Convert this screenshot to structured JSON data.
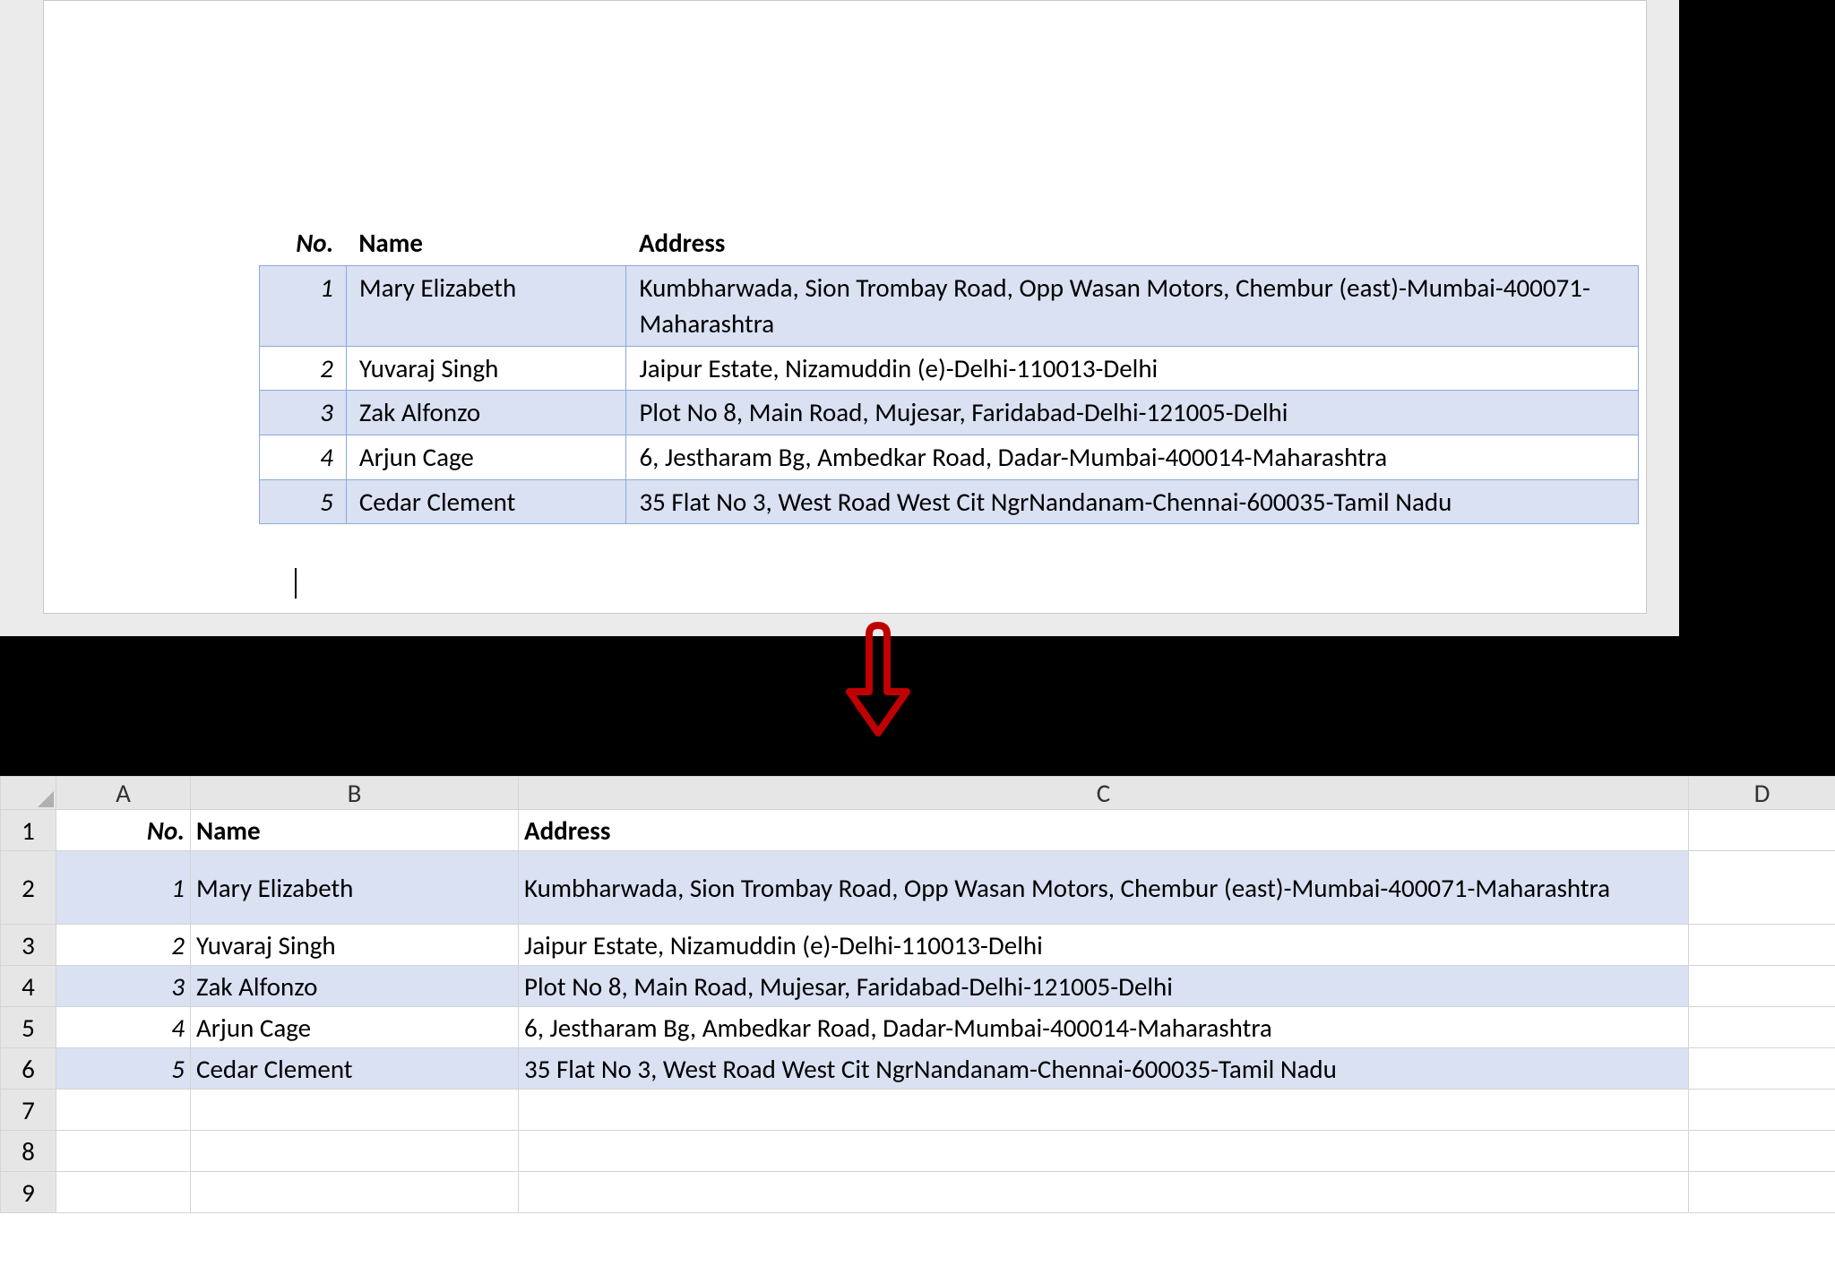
{
  "columns": {
    "A": "A",
    "B": "B",
    "C": "C",
    "D": "D"
  },
  "headers": {
    "no": "No.",
    "name": "Name",
    "address": "Address"
  },
  "rows": [
    {
      "no": "1",
      "name": "Mary Elizabeth",
      "address_top": "Kumbharwada, Sion Trombay Road, Opp Wasan Motors, Chembur (east)-Mumbai-400071-Maharashtra",
      "address_bottom": "Kumbharwada, Sion Trombay Road, Opp Wasan Motors, Chembur (east)-Mumbai-400071-Maharashtra"
    },
    {
      "no": "2",
      "name": "Yuvaraj Singh",
      "address_top": "Jaipur Estate, Nizamuddin (e)-Delhi-110013-Delhi",
      "address_bottom": "Jaipur Estate, Nizamuddin (e)-Delhi-110013-Delhi"
    },
    {
      "no": "3",
      "name": "Zak Alfonzo",
      "address_top": "Plot No 8, Main Road, Mujesar, Faridabad-Delhi-121005-Delhi",
      "address_bottom": "Plot No 8, Main Road, Mujesar, Faridabad-Delhi-121005-Delhi"
    },
    {
      "no": "4",
      "name": "Arjun Cage",
      "address_top": "6, Jestharam Bg, Ambedkar Road, Dadar-Mumbai-400014-Maharashtra",
      "address_bottom": "6, Jestharam Bg, Ambedkar Road, Dadar-Mumbai-400014-Maharashtra"
    },
    {
      "no": "5",
      "name": "Cedar Clement",
      "address_top": "35 Flat No 3, West Road West Cit NgrNandanam-Chennai-600035-Tamil Nadu",
      "address_bottom": "35 Flat No 3, West Road West Cit NgrNandanam-Chennai-600035-Tamil Nadu"
    }
  ],
  "row_numbers": [
    "1",
    "2",
    "3",
    "4",
    "5",
    "6",
    "7",
    "8",
    "9"
  ]
}
